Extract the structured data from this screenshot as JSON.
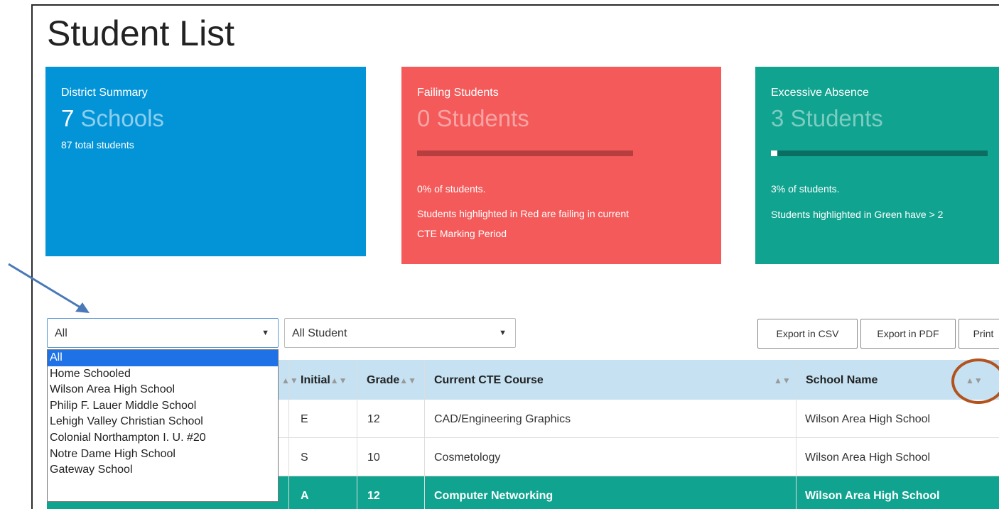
{
  "page": {
    "title": "Student List"
  },
  "cards": {
    "district": {
      "title": "District Summary",
      "count": "7",
      "unit": "Schools",
      "sub": "87 total students",
      "color": "#0394d8"
    },
    "failing": {
      "title": "Failing Students",
      "count": "0",
      "unit": "Students",
      "percent_text": "0% of students.",
      "progress": 0.0,
      "note": "Students highlighted in Red are failing in current",
      "note2": "CTE Marking Period",
      "color": "#f45a5a"
    },
    "absence": {
      "title": "Excessive Absence",
      "count": "3",
      "unit": "Students",
      "percent_text": "3% of students.",
      "progress": 0.03,
      "note": "Students highlighted in Green have > 2",
      "color": "#10a38f"
    }
  },
  "filters": {
    "school": {
      "value": "All",
      "options": [
        "All",
        "Home Schooled",
        "Wilson Area High School",
        "Philip F. Lauer Middle School",
        "Lehigh Valley Christian School",
        "Colonial Northampton I. U. #20",
        "Notre Dame High School",
        "Gateway School"
      ],
      "selected_index": 0
    },
    "student": {
      "value": "All Student"
    }
  },
  "actions": {
    "csv": "Export in CSV",
    "pdf": "Export in PDF",
    "print": "Print"
  },
  "table": {
    "headers": {
      "initial": "Initial",
      "grade": "Grade",
      "course": "Current CTE Course",
      "school": "School Name"
    },
    "rows": [
      {
        "initial": "E",
        "grade": "12",
        "course": "CAD/Engineering Graphics",
        "school": "Wilson Area High School",
        "highlight": false
      },
      {
        "initial": "S",
        "grade": "10",
        "course": "Cosmetology",
        "school": "Wilson Area High School",
        "highlight": false
      },
      {
        "initial": "A",
        "grade": "12",
        "course": "Computer Networking",
        "school": "Wilson Area High School",
        "highlight": true
      }
    ]
  },
  "icons": {
    "sort": "sort-icon",
    "caret": "caret-down-icon",
    "annotation_arrow": "arrow-icon",
    "annotation_circle": "circle-highlight"
  },
  "colors": {
    "header_bg": "#c5e1f2",
    "highlight_row": "#10a38f",
    "annotation_arrow": "#4a79b8",
    "annotation_circle": "#b3521c"
  }
}
